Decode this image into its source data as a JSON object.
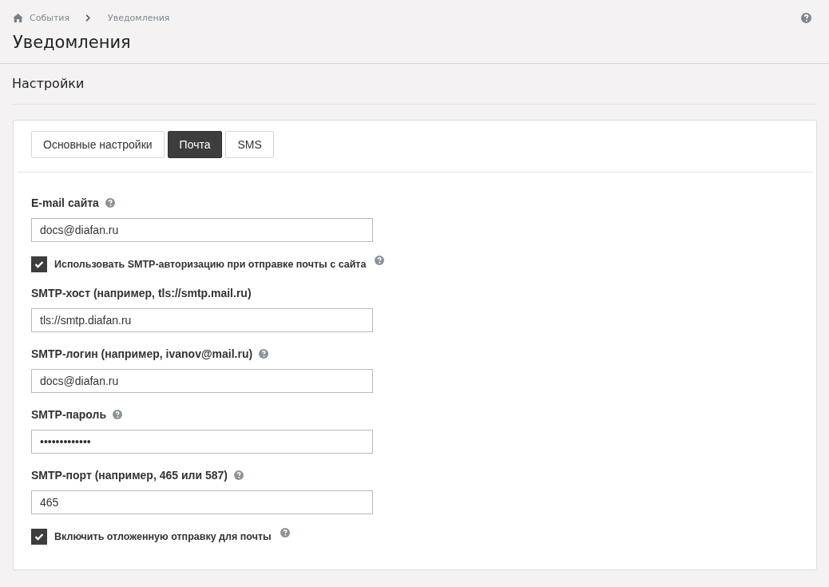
{
  "breadcrumb": [
    {
      "label": "События"
    },
    {
      "label": "Уведомления"
    }
  ],
  "page_title": "Уведомления",
  "section_title": "Настройки",
  "tabs": [
    {
      "label": "Основные настройки",
      "selected": false
    },
    {
      "label": "Почта",
      "selected": true
    },
    {
      "label": "SMS",
      "selected": false
    }
  ],
  "fields": [
    {
      "kind": "field",
      "label": "E-mail сайта",
      "help": true,
      "value": "docs@diafan.ru"
    },
    {
      "kind": "checkbox",
      "label": "Использовать SMTP-авторизацию при отправке почты с сайта",
      "help": true,
      "checked": true
    },
    {
      "kind": "field",
      "label": "SMTP-хост (например, tls://smtp.mail.ru)",
      "help": false,
      "value": "tls://smtp.diafan.ru"
    },
    {
      "kind": "field",
      "label": "SMTP-логин (например, ivanov@mail.ru)",
      "help": true,
      "value": "docs@diafan.ru"
    },
    {
      "kind": "field",
      "label": "SMTP-пароль",
      "help": true,
      "value": "•••••••••••••"
    },
    {
      "kind": "field",
      "label": "SMTP-порт (например, 465 или 587)",
      "help": true,
      "value": "465"
    },
    {
      "kind": "checkbox",
      "label": "Включить отложенную отправку для почты",
      "help": true,
      "checked": true
    }
  ]
}
